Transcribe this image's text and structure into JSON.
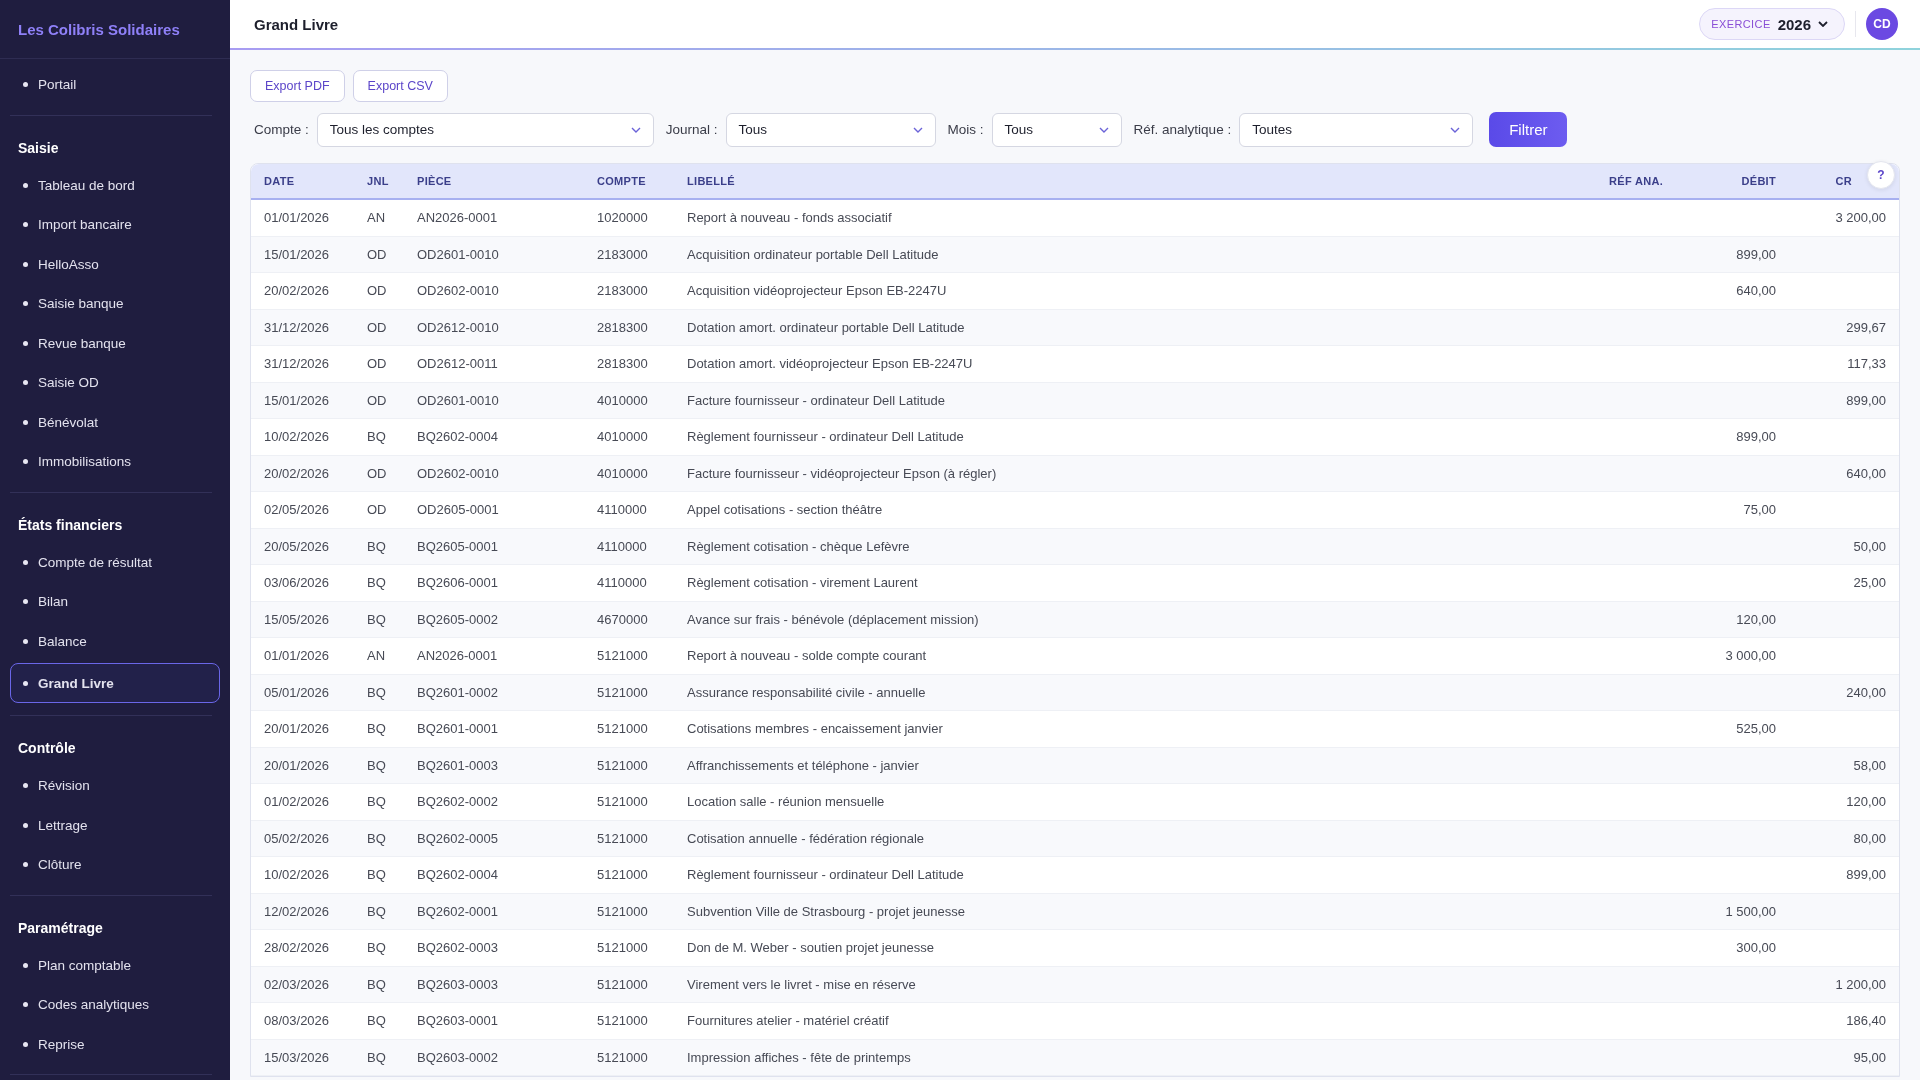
{
  "sidebar": {
    "brand": "Les Colibris Solidaires",
    "sections": [
      {
        "items": [
          {
            "label": "Portail",
            "selected": false
          }
        ]
      },
      {
        "title": "Saisie",
        "items": [
          {
            "label": "Tableau de bord",
            "selected": false
          },
          {
            "label": "Import bancaire",
            "selected": false
          },
          {
            "label": "HelloAsso",
            "selected": false
          },
          {
            "label": "Saisie banque",
            "selected": false
          },
          {
            "label": "Revue banque",
            "selected": false
          },
          {
            "label": "Saisie OD",
            "selected": false
          },
          {
            "label": "Bénévolat",
            "selected": false
          },
          {
            "label": "Immobilisations",
            "selected": false
          }
        ]
      },
      {
        "title": "États financiers",
        "items": [
          {
            "label": "Compte de résultat",
            "selected": false
          },
          {
            "label": "Bilan",
            "selected": false
          },
          {
            "label": "Balance",
            "selected": false
          },
          {
            "label": "Grand Livre",
            "selected": true
          }
        ]
      },
      {
        "title": "Contrôle",
        "items": [
          {
            "label": "Révision",
            "selected": false
          },
          {
            "label": "Lettrage",
            "selected": false
          },
          {
            "label": "Clôture",
            "selected": false
          }
        ]
      },
      {
        "title": "Paramétrage",
        "items": [
          {
            "label": "Plan comptable",
            "selected": false
          },
          {
            "label": "Codes analytiques",
            "selected": false
          },
          {
            "label": "Reprise",
            "selected": false
          }
        ]
      }
    ]
  },
  "header": {
    "title": "Grand Livre",
    "exercise_label": "EXERCICE",
    "exercise_value": "2026",
    "avatar": "CD"
  },
  "toolbar": {
    "exports": [
      "Export PDF",
      "Export CSV"
    ],
    "filters": [
      {
        "label": "Compte :",
        "value": "Tous les comptes"
      },
      {
        "label": "Journal :",
        "value": "Tous"
      },
      {
        "label": "Mois :",
        "value": "Tous"
      },
      {
        "label": "Réf. analytique :",
        "value": "Toutes"
      }
    ],
    "filter_button": "Filtrer"
  },
  "table": {
    "columns": [
      "DATE",
      "JNL",
      "PIÈCE",
      "COMPTE",
      "LIBELLÉ",
      "RÉF ANA.",
      "DÉBIT",
      "CR"
    ],
    "help_button": "?",
    "rows": [
      [
        "01/01/2026",
        "AN",
        "AN2026-0001",
        "1020000",
        "Report à nouveau - fonds associatif",
        "",
        "",
        "3 200,00"
      ],
      [
        "15/01/2026",
        "OD",
        "OD2601-0010",
        "2183000",
        "Acquisition ordinateur portable Dell Latitude",
        "",
        "899,00",
        ""
      ],
      [
        "20/02/2026",
        "OD",
        "OD2602-0010",
        "2183000",
        "Acquisition vidéoprojecteur Epson EB-2247U",
        "",
        "640,00",
        ""
      ],
      [
        "31/12/2026",
        "OD",
        "OD2612-0010",
        "2818300",
        "Dotation amort. ordinateur portable Dell Latitude",
        "",
        "",
        "299,67"
      ],
      [
        "31/12/2026",
        "OD",
        "OD2612-0011",
        "2818300",
        "Dotation amort. vidéoprojecteur Epson EB-2247U",
        "",
        "",
        "117,33"
      ],
      [
        "15/01/2026",
        "OD",
        "OD2601-0010",
        "4010000",
        "Facture fournisseur - ordinateur Dell Latitude",
        "",
        "",
        "899,00"
      ],
      [
        "10/02/2026",
        "BQ",
        "BQ2602-0004",
        "4010000",
        "Règlement fournisseur - ordinateur Dell Latitude",
        "",
        "899,00",
        ""
      ],
      [
        "20/02/2026",
        "OD",
        "OD2602-0010",
        "4010000",
        "Facture fournisseur - vidéoprojecteur Epson (à régler)",
        "",
        "",
        "640,00"
      ],
      [
        "02/05/2026",
        "OD",
        "OD2605-0001",
        "4110000",
        "Appel cotisations - section théâtre",
        "",
        "75,00",
        ""
      ],
      [
        "20/05/2026",
        "BQ",
        "BQ2605-0001",
        "4110000",
        "Règlement cotisation - chèque Lefèvre",
        "",
        "",
        "50,00"
      ],
      [
        "03/06/2026",
        "BQ",
        "BQ2606-0001",
        "4110000",
        "Règlement cotisation - virement Laurent",
        "",
        "",
        "25,00"
      ],
      [
        "15/05/2026",
        "BQ",
        "BQ2605-0002",
        "4670000",
        "Avance sur frais - bénévole (déplacement mission)",
        "",
        "120,00",
        ""
      ],
      [
        "01/01/2026",
        "AN",
        "AN2026-0001",
        "5121000",
        "Report à nouveau - solde compte courant",
        "",
        "3 000,00",
        ""
      ],
      [
        "05/01/2026",
        "BQ",
        "BQ2601-0002",
        "5121000",
        "Assurance responsabilité civile - annuelle",
        "",
        "",
        "240,00"
      ],
      [
        "20/01/2026",
        "BQ",
        "BQ2601-0001",
        "5121000",
        "Cotisations membres - encaissement janvier",
        "",
        "525,00",
        ""
      ],
      [
        "20/01/2026",
        "BQ",
        "BQ2601-0003",
        "5121000",
        "Affranchissements et téléphone - janvier",
        "",
        "",
        "58,00"
      ],
      [
        "01/02/2026",
        "BQ",
        "BQ2602-0002",
        "5121000",
        "Location salle - réunion mensuelle",
        "",
        "",
        "120,00"
      ],
      [
        "05/02/2026",
        "BQ",
        "BQ2602-0005",
        "5121000",
        "Cotisation annuelle - fédération régionale",
        "",
        "",
        "80,00"
      ],
      [
        "10/02/2026",
        "BQ",
        "BQ2602-0004",
        "5121000",
        "Règlement fournisseur - ordinateur Dell Latitude",
        "",
        "",
        "899,00"
      ],
      [
        "12/02/2026",
        "BQ",
        "BQ2602-0001",
        "5121000",
        "Subvention Ville de Strasbourg - projet jeunesse",
        "",
        "1 500,00",
        ""
      ],
      [
        "28/02/2026",
        "BQ",
        "BQ2602-0003",
        "5121000",
        "Don de M. Weber - soutien projet jeunesse",
        "",
        "300,00",
        ""
      ],
      [
        "02/03/2026",
        "BQ",
        "BQ2603-0003",
        "5121000",
        "Virement vers le livret - mise en réserve",
        "",
        "",
        "1 200,00"
      ],
      [
        "08/03/2026",
        "BQ",
        "BQ2603-0001",
        "5121000",
        "Fournitures atelier - matériel créatif",
        "",
        "",
        "186,40"
      ],
      [
        "15/03/2026",
        "BQ",
        "BQ2603-0002",
        "5121000",
        "Impression affiches - fête de printemps",
        "",
        "",
        "95,00"
      ]
    ]
  }
}
